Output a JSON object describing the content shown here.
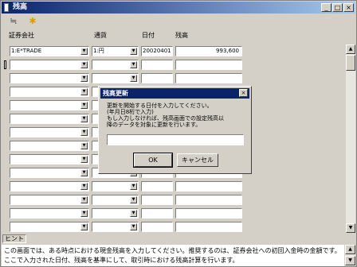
{
  "window": {
    "title": "残高",
    "minimize": "_",
    "maximize": "□",
    "close": "×"
  },
  "toolbar": {
    "sort_icon": "≒",
    "new_icon": "✱"
  },
  "columns": {
    "broker": "証券会社",
    "currency": "通貨",
    "date": "日付",
    "balance": "残高"
  },
  "rows": [
    {
      "broker": "1:E*TRADE",
      "currency": "1:円",
      "date": "20020401",
      "balance": "993,600"
    },
    {
      "broker": "",
      "currency": "",
      "date": "",
      "balance": ""
    },
    {
      "broker": "",
      "currency": "",
      "date": "",
      "balance": ""
    },
    {
      "broker": "",
      "currency": "",
      "date": "",
      "balance": ""
    },
    {
      "broker": "",
      "currency": "",
      "date": "",
      "balance": ""
    },
    {
      "broker": "",
      "currency": "",
      "date": "",
      "balance": ""
    },
    {
      "broker": "",
      "currency": "",
      "date": "",
      "balance": ""
    },
    {
      "broker": "",
      "currency": "",
      "date": "",
      "balance": ""
    },
    {
      "broker": "",
      "currency": "",
      "date": "",
      "balance": ""
    },
    {
      "broker": "",
      "currency": "",
      "date": "",
      "balance": ""
    },
    {
      "broker": "",
      "currency": "",
      "date": "",
      "balance": ""
    },
    {
      "broker": "",
      "currency": "",
      "date": "",
      "balance": ""
    },
    {
      "broker": "",
      "currency": "",
      "date": "",
      "balance": ""
    },
    {
      "broker": "",
      "currency": "",
      "date": "",
      "balance": ""
    }
  ],
  "scroll": {
    "up": "▲",
    "down": "▼"
  },
  "hint": {
    "label": "ヒント",
    "text": "この画面では、ある時点における現金残高を入力してください。推奨するのは、証券会社への初回入金時の金額です。ここで入力された日付、残高を基準にして、取引時における残高計算を行います。"
  },
  "dialog": {
    "title": "残高更新",
    "message": "更新を開始する日付を入力してください。\n(年月日8桁で入力)\nもし入力しなければ、残高画面での設定残高以\n降のデータを対象に更新を行います。",
    "input_value": "",
    "ok_label": "OK",
    "cancel_label": "キャンセル",
    "close": "×"
  }
}
